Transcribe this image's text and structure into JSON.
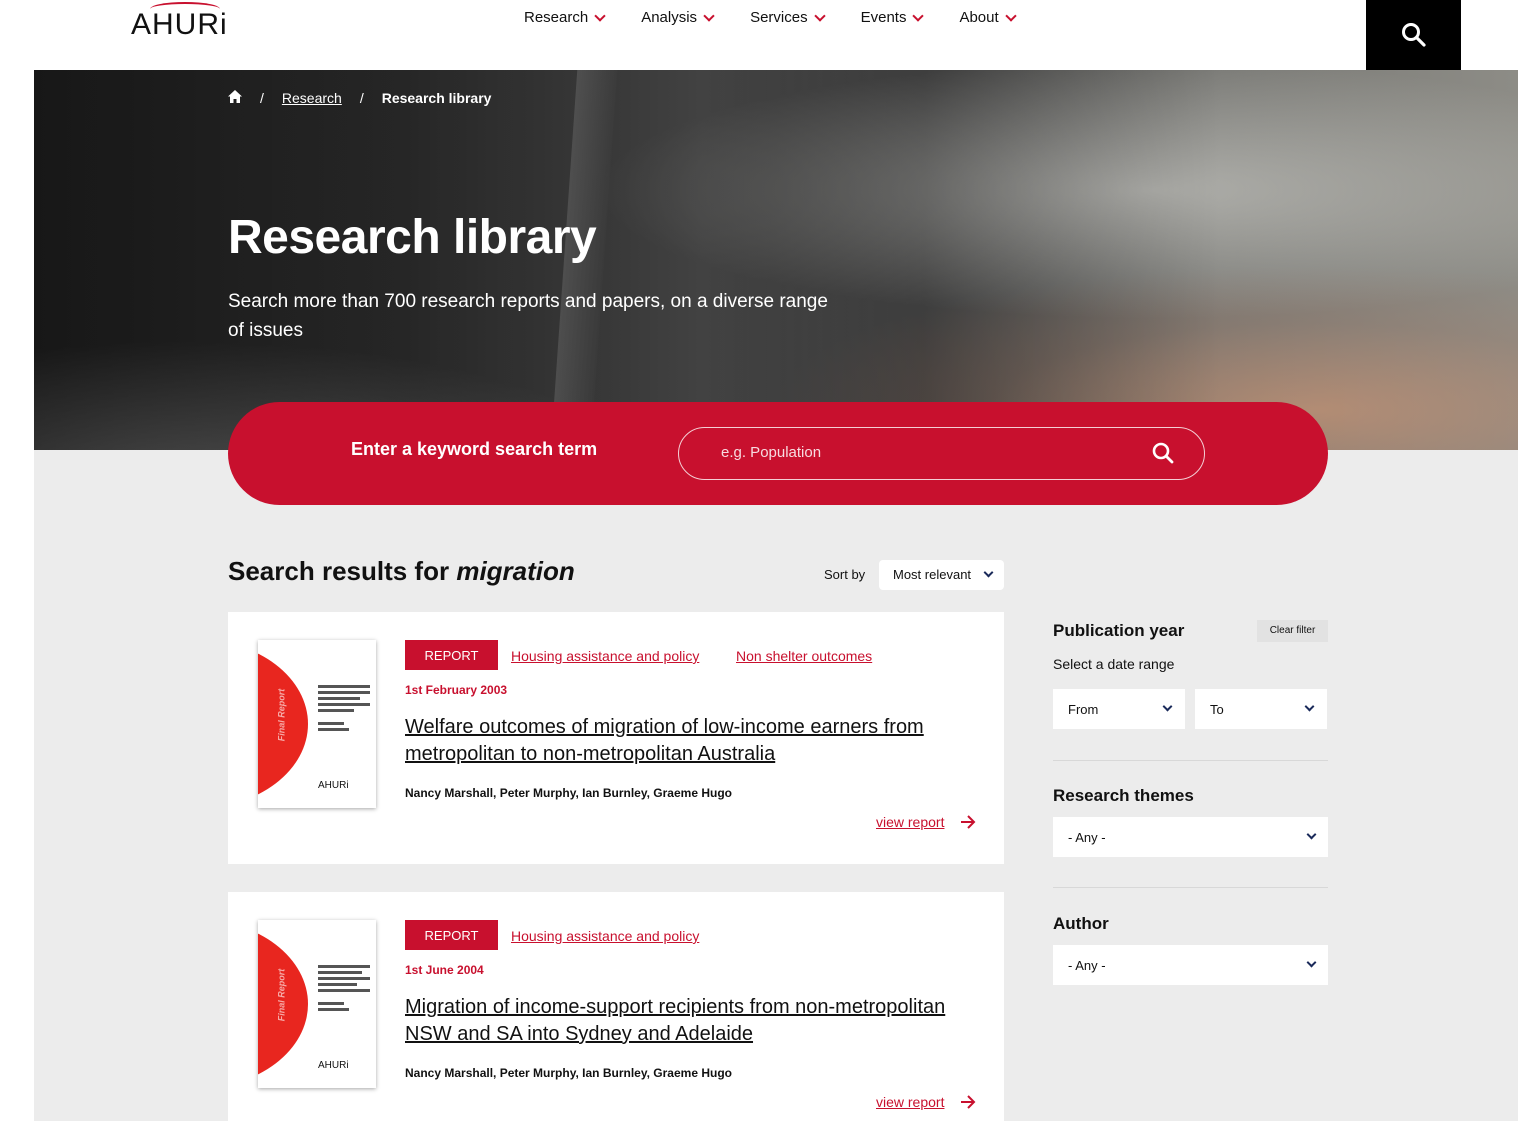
{
  "header": {
    "logo": "AHURi",
    "nav": [
      "Research",
      "Analysis",
      "Services",
      "Events",
      "About"
    ]
  },
  "breadcrumb": {
    "home_icon": "home-icon",
    "items": [
      "Research",
      "Research library"
    ]
  },
  "hero": {
    "title": "Research library",
    "subtitle": "Search more than 700 research reports and papers, on a diverse range of issues"
  },
  "search": {
    "label": "Enter a keyword search term",
    "placeholder": "e.g. Population"
  },
  "results": {
    "title_prefix": "Search results for",
    "term": "migration",
    "sort_label": "Sort by",
    "sort_value": "Most relevant"
  },
  "cards": [
    {
      "tag": "REPORT",
      "topics": [
        "Housing assistance and policy",
        "Non shelter outcomes"
      ],
      "date": "1st February 2003",
      "title": "Welfare outcomes of migration of low-income earners from metropolitan to non-metropolitan Australia",
      "authors": "Nancy Marshall, Peter Murphy, Ian Burnley, Graeme Hugo",
      "link": "view report",
      "thumb_label": "Final Report",
      "thumb_logo": "AHURi"
    },
    {
      "tag": "REPORT",
      "topics": [
        "Housing assistance and policy"
      ],
      "date": "1st June 2004",
      "title": "Migration of income-support recipients from non-metropolitan NSW and SA into Sydney and Adelaide",
      "authors": "Nancy Marshall, Peter Murphy, Ian Burnley, Graeme Hugo",
      "link": "view report",
      "thumb_label": "Final Report",
      "thumb_logo": "AHURi"
    }
  ],
  "sidebar": {
    "publication_year": {
      "heading": "Publication year",
      "clear": "Clear filter",
      "subheading": "Select a date range",
      "from": "From",
      "to": "To"
    },
    "themes": {
      "heading": "Research themes",
      "value": "- Any -"
    },
    "author": {
      "heading": "Author",
      "value": "- Any -"
    }
  },
  "colors": {
    "brand_red": "#c8102e",
    "background_gray": "#ececec"
  }
}
